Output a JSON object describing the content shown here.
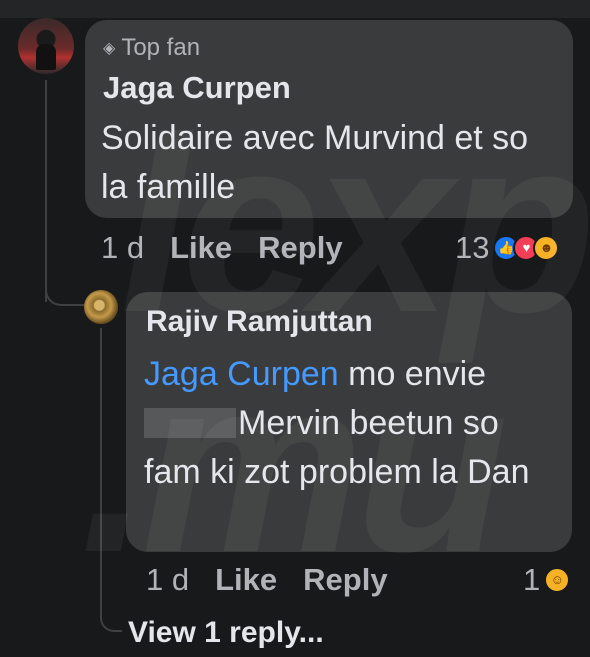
{
  "comment": {
    "badge": "Top fan",
    "badge_icon": "diamond-icon",
    "author": "Jaga Curpen",
    "text": "Solidaire avec Murvind et so la famille",
    "time": "1 d",
    "like_label": "Like",
    "reply_label": "Reply",
    "reaction_count": "13",
    "reactions": [
      "like-icon",
      "love-icon",
      "care-icon"
    ]
  },
  "reply": {
    "author": "Rajiv Ramjuttan",
    "mention": "Jaga Curpen",
    "text_part1": " mo envie",
    "text_part2": "Mervin beetun so fam ki zot problem la Dan",
    "time": "1 d",
    "like_label": "Like",
    "reply_label": "Reply",
    "reaction_count": "1",
    "reactions": [
      "haha-icon"
    ]
  },
  "view_replies": "View 1 reply...",
  "watermark": "lexp",
  "watermark2": ".mu",
  "colors": {
    "background": "#18191a",
    "bubble": "#3a3b3c",
    "mention": "#4599ff",
    "secondary_text": "#b0b3b8"
  }
}
